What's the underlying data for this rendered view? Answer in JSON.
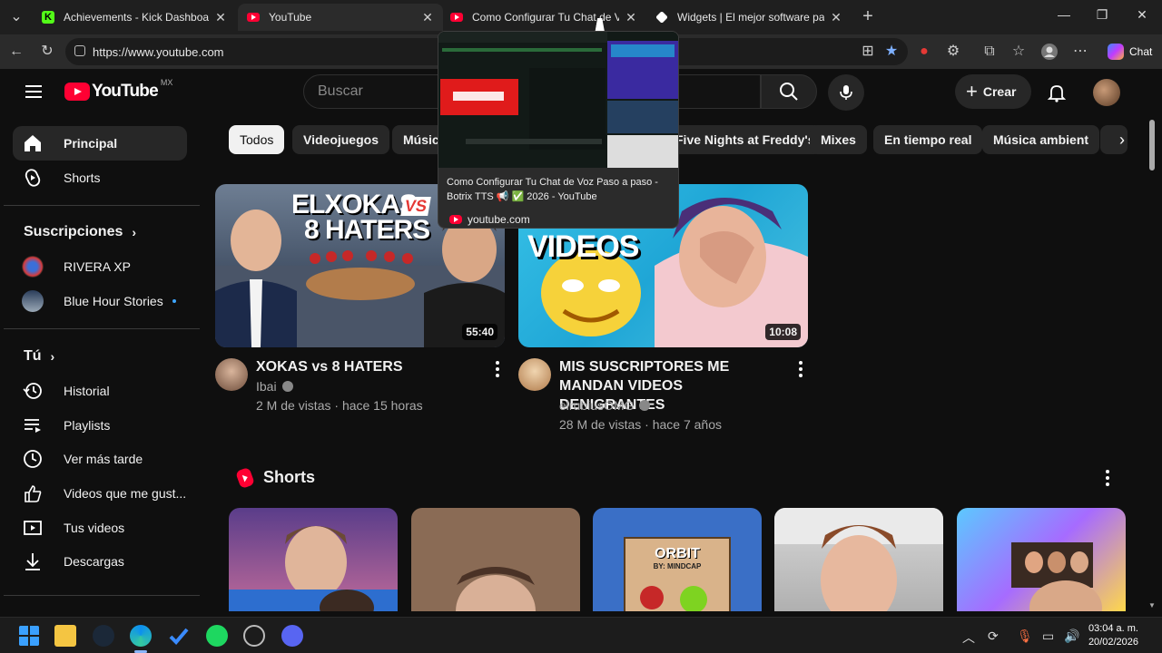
{
  "browser": {
    "tabs": [
      {
        "title": "Achievements - Kick Dashboard",
        "favicon": "kick-icon"
      },
      {
        "title": "YouTube",
        "favicon": "youtube-icon",
        "active": true
      },
      {
        "title": "Como Configurar Tu Chat de Voz Pa",
        "favicon": "youtube-icon"
      },
      {
        "title": "Widgets | El mejor software para p",
        "favicon": "widgets-icon"
      }
    ],
    "url": "https://www.youtube.com",
    "chat_label": "Chat"
  },
  "tooltip": {
    "title": "Como Configurar Tu Chat de Voz Paso a paso - Botrix TTS 📢 ✅ 2026 - YouTube",
    "domain": "youtube.com"
  },
  "header": {
    "logo_text": "YouTube",
    "country": "MX",
    "search_placeholder": "Buscar",
    "create_label": "Crear"
  },
  "sidebar": {
    "main": [
      {
        "label": "Principal",
        "icon": "home-icon"
      },
      {
        "label": "Shorts",
        "icon": "shorts-icon"
      }
    ],
    "subs_heading": "Suscripciones",
    "subs": [
      {
        "label": "RIVERA XP"
      },
      {
        "label": "Blue Hour Stories"
      }
    ],
    "you_heading": "Tú",
    "you": [
      {
        "label": "Historial",
        "icon": "history-icon"
      },
      {
        "label": "Playlists",
        "icon": "playlist-icon"
      },
      {
        "label": "Ver más tarde",
        "icon": "clock-icon"
      },
      {
        "label": "Videos que me gust...",
        "icon": "thumbs-up-icon"
      },
      {
        "label": "Tus videos",
        "icon": "video-icon"
      },
      {
        "label": "Descargas",
        "icon": "download-icon"
      }
    ]
  },
  "chips": [
    "Todos",
    "Videojuegos",
    "Música",
    "Five Nights at Freddy's",
    "Mixes",
    "En tiempo real",
    "Música ambient"
  ],
  "videos": [
    {
      "thumb_text_1": "ELXOKAS",
      "thumb_vs": "VS",
      "thumb_text_2": "8 HATERS",
      "duration": "55:40",
      "title": "XOKAS vs 8 HATERS",
      "channel": "Ibai",
      "views": "2 M de vistas",
      "age": "hace 15 horas"
    },
    {
      "thumb_text_1": "VIDEOS",
      "duration": "10:08",
      "title": "MIS SUSCRIPTORES ME MANDAN VIDEOS DENIGRANTES",
      "channel": "elrubiusOMG",
      "views": "28 M de vistas",
      "age": "hace 7 años"
    }
  ],
  "shorts": {
    "heading": "Shorts",
    "orbit_title": "ORBIT",
    "orbit_sub": "BY: MINDCAP"
  },
  "taskbar": {
    "time": "03:04 a. m.",
    "date": "20/02/2026"
  },
  "colors": {
    "yt_red": "#ff0033",
    "background": "#0f0f0f",
    "chip_bg": "#272727"
  }
}
